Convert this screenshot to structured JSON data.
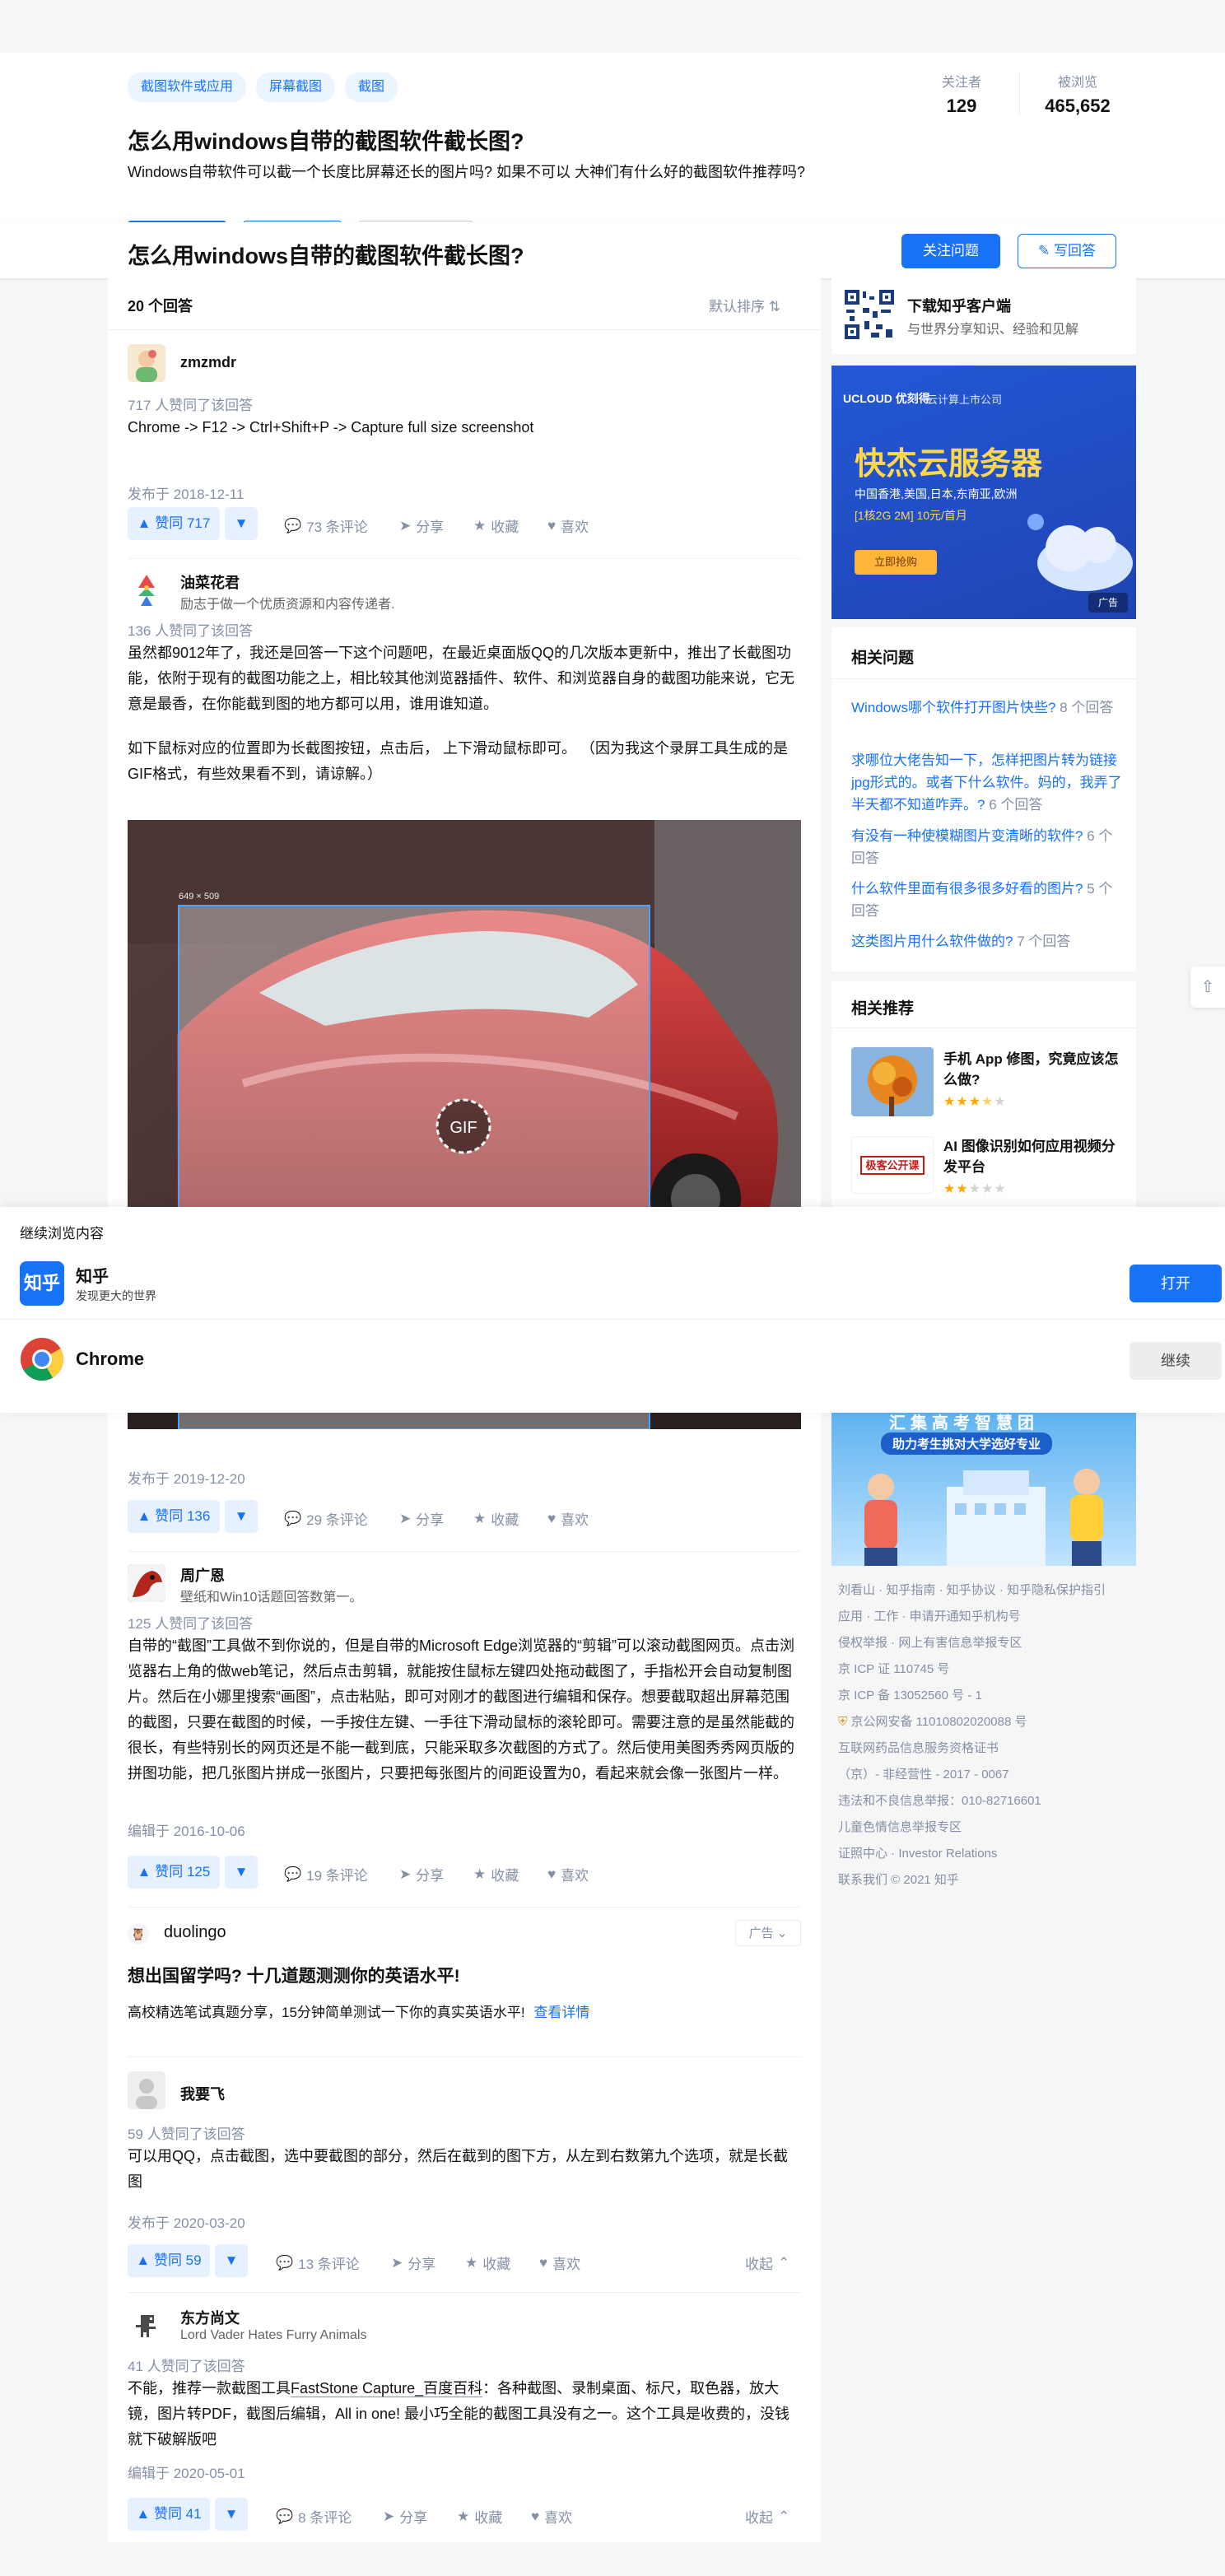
{
  "question": {
    "tags": [
      "截图软件或应用",
      "屏幕截图",
      "截图"
    ],
    "title": "怎么用windows自带的截图软件截长图?",
    "detail": "Windows自带软件可以截一个长度比屏幕还长的图片吗? 如果不可以 大神们有什么好的截图软件推荐吗?",
    "followers_label": "关注者",
    "followers": "129",
    "views_label": "被浏览",
    "views": "465,652",
    "follow_button": "关注问题",
    "write_button": "写回答"
  },
  "answers_header": {
    "count": "20 个回答",
    "sort": "默认排序"
  },
  "answers": [
    {
      "author": "zmzmdr",
      "bio": "",
      "votes": "717 人赞同了该回答",
      "content": "Chrome -> F12 -> Ctrl+Shift+P -> Capture full size screenshot",
      "time": "发布于 2018-12-11",
      "vote_btn": "▲ 赞同 717",
      "comments": "73 条评论",
      "share": "分享",
      "collect": "收藏",
      "like": "喜欢"
    },
    {
      "author": "油菜花君",
      "bio": "励志于做一个优质资源和内容传递者.",
      "votes": "136 人赞同了该回答",
      "content_1": "虽然都9012年了，我还是回答一下这个问题吧，在最近桌面版QQ的几次版本更新中，推出了长截图功能，依附于现有的截图功能之上，相比较其他浏览器插件、软件、和浏览器自身的截图功能来说，它无意是最香，在你能截到图的地方都可以用，谁用谁知道。",
      "content_2": "如下鼠标对应的位置即为长截图按钮，点击后， 上下滑动鼠标即可。 （因为我这个录屏工具生成的是GIF格式，有些效果看不到，请谅解。）",
      "image_size": "649 × 509",
      "gif_label": "GIF",
      "time": "发布于 2019-12-20",
      "vote_btn": "▲ 赞同 136",
      "comments": "29 条评论",
      "share": "分享",
      "collect": "收藏",
      "like": "喜欢"
    },
    {
      "author": "周广恩",
      "bio": "壁纸和Win10话题回答数第一。",
      "votes": "125 人赞同了该回答",
      "content": "自带的“截图”工具做不到你说的，但是自带的Microsoft Edge浏览器的“剪辑”可以滚动截图网页。点击浏览器右上角的做web笔记，然后点击剪辑，就能按住鼠标左键四处拖动截图了，手指松开会自动复制图片。然后在小娜里搜索“画图”，点击粘贴，即可对刚才的截图进行编辑和保存。想要截取超出屏幕范围的截图，只要在截图的时候，一手按住左键、一手往下滑动鼠标的滚轮即可。需要注意的是虽然能截的很长，有些特别长的网页还是不能一截到底，只能采取多次截图的方式了。然后使用美图秀秀网页版的拼图功能，把几张图片拼成一张图片，只要把每张图片的间距设置为0，看起来就会像一张图片一样。",
      "time": "编辑于 2016-10-06",
      "vote_btn": "▲ 赞同 125",
      "comments": "19 条评论",
      "share": "分享",
      "collect": "收藏",
      "like": "喜欢"
    },
    {
      "author": "我要飞",
      "bio": "",
      "votes": "59 人赞同了该回答",
      "content": "可以用QQ，点击截图，选中要截图的部分，然后在截到的图下方，从左到右数第九个选项，就是长截图",
      "time": "发布于 2020-03-20",
      "vote_btn": "▲ 赞同 59",
      "comments": "13 条评论",
      "share": "分享",
      "collect": "收藏",
      "like": "喜欢",
      "collapse": "收起"
    },
    {
      "author": "东方尚文",
      "bio": "Lord Vader Hates Furry Animals",
      "votes": "41 人赞同了该回答",
      "content_pre": "不能，推荐一款截图工具",
      "content_link": "FastStone Capture_百度百科",
      "content_post": "：各种截图、录制桌面、标尺，取色器，放大镜，图片转PDF，截图后编辑，All in one! 最小巧全能的截图工具没有之一。这个工具是收费的，没钱就下破解版吧",
      "time": "编辑于 2020-05-01",
      "vote_btn": "▲ 赞同 41",
      "comments": "8 条评论",
      "share": "分享",
      "collect": "收藏",
      "like": "喜欢",
      "collapse": "收起"
    }
  ],
  "ad": {
    "brand": "duolingo",
    "label": "广告",
    "title": "想出国留学吗? 十几道题测测你的英语水平!",
    "desc": "高校精选笔试真题分享，15分钟简单测试一下你的真实英语水平!",
    "link": "查看详情"
  },
  "sidebar": {
    "app_title": "下载知乎客户端",
    "app_desc": "与世界分享知识、经验和见解",
    "banner_brand": "UCLOUD 优刻得",
    "banner_sub": "云计算上市公司",
    "banner_title": "快杰云服务器",
    "banner_regions": "中国香港,美国,日本,东南亚,欧洲",
    "banner_price": "[1核2G 2M] 10元/首月",
    "banner_cta": "立即抢购",
    "banner_ad": "广告",
    "related_title": "相关问题",
    "related": [
      {
        "q": "Windows哪个软件打开图片快些?",
        "n": "8 个回答"
      },
      {
        "q": "求哪位大佬告知一下，怎样把图片转为链接jpg形式的。或者下什么软件。妈的，我弄了半天都不知道咋弄。?",
        "n": "6 个回答"
      },
      {
        "q": "有没有一种使模糊图片变清晰的软件?",
        "n": "6 个回答"
      },
      {
        "q": "什么软件里面有很多很多好看的图片?",
        "n": "5 个回答"
      },
      {
        "q": "这类图片用什么软件做的?",
        "n": "7 个回答"
      }
    ],
    "recommend_title": "相关推荐",
    "recommend": [
      {
        "t": "手机 App 修图，究竟应该怎么做?",
        "stars": 3.5,
        "logo": ""
      },
      {
        "t": "AI 图像识别如何应用视频分发平台",
        "stars": 2,
        "logo": "极客公开课"
      }
    ],
    "banner2_top": "汇集高考智慧团",
    "banner2_sub": "助力考生挑对大学选好专业",
    "footer": [
      "刘看山 · 知乎指南 · 知乎协议 · 知乎隐私保护指引",
      "应用 · 工作 · 申请开通知乎机构号",
      "侵权举报 · 网上有害信息举报专区",
      "京 ICP 证 110745 号",
      "京 ICP 备 13052560 号 - 1",
      "京公网安备 11010802020088 号",
      "互联网药品信息服务资格证书",
      "（京）- 非经营性 - 2017 - 0067",
      "违法和不良信息举报：010-82716601",
      "儿童色情信息举报专区",
      "证照中心 · Investor Relations",
      "联系我们 © 2021 知乎"
    ]
  },
  "app_prompt": {
    "title": "继续浏览内容",
    "zhihu_name": "知乎",
    "zhihu_logo": "知乎",
    "zhihu_desc": "发现更大的世界",
    "open_btn": "打开",
    "chrome_name": "Chrome",
    "continue_btn": "继续"
  },
  "colors": {
    "accent": "#1772f6",
    "vote_bg": "#e6f0ff",
    "banner_blue": "#1d4fc4",
    "banner_yellow": "#ffd84a"
  }
}
